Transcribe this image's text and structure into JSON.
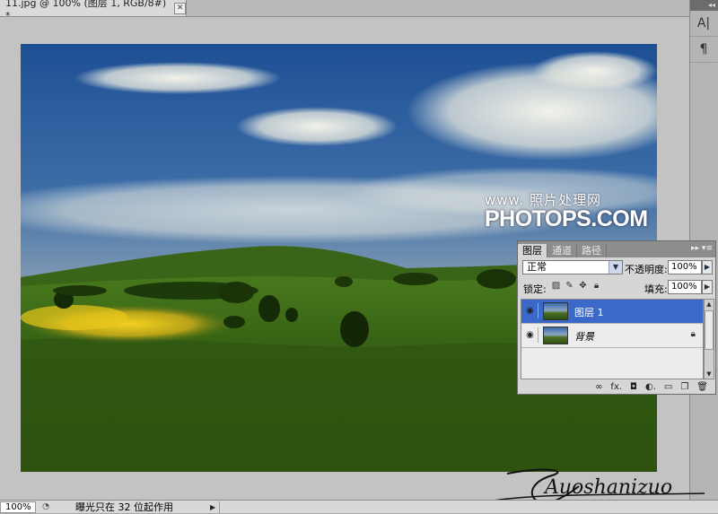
{
  "document": {
    "tab_title": "11.jpg @ 100% (图层 1, RGB/8#) *",
    "close_glyph": "✕"
  },
  "canvas": {
    "watermark_url": "www.   照片处理网",
    "watermark_brand": "PHOTOPS.COM",
    "signature_text": "Auoshanizuo"
  },
  "dock": {
    "collapse_glyph": "◂◂",
    "tools": [
      {
        "icon": "character-panel-icon",
        "glyph": "A|"
      },
      {
        "icon": "paragraph-panel-icon",
        "glyph": "¶"
      }
    ]
  },
  "layers_panel": {
    "tabs": [
      {
        "label": "图层",
        "active": true
      },
      {
        "label": "通道",
        "active": false
      },
      {
        "label": "路径",
        "active": false
      }
    ],
    "menu_glyph": "▸▸ ▾≡",
    "blend_mode": "正常",
    "opacity_label": "不透明度:",
    "opacity_value": "100%",
    "lock_label": "锁定:",
    "fill_label": "填充:",
    "fill_value": "100%",
    "layers": [
      {
        "name": "图层 1",
        "selected": true,
        "locked": false
      },
      {
        "name": "背景",
        "selected": false,
        "locked": true
      }
    ],
    "footer_buttons": [
      {
        "icon": "link-layers-icon",
        "glyph": "∞"
      },
      {
        "icon": "layer-style-icon",
        "glyph": "fx."
      },
      {
        "icon": "layer-mask-icon",
        "glyph": "◘"
      },
      {
        "icon": "adjustment-layer-icon",
        "glyph": "◐."
      },
      {
        "icon": "new-group-icon",
        "glyph": "▭"
      },
      {
        "icon": "new-layer-icon",
        "glyph": "❐"
      },
      {
        "icon": "delete-layer-icon",
        "glyph": "🗑"
      }
    ]
  },
  "status_bar": {
    "zoom": "100%",
    "info_text": "曝光只在 32 位起作用"
  },
  "colors": {
    "selection_blue": "#3b69c9",
    "panel_gray": "#d6d6d6",
    "canvas_gray": "#c3c3c3"
  }
}
